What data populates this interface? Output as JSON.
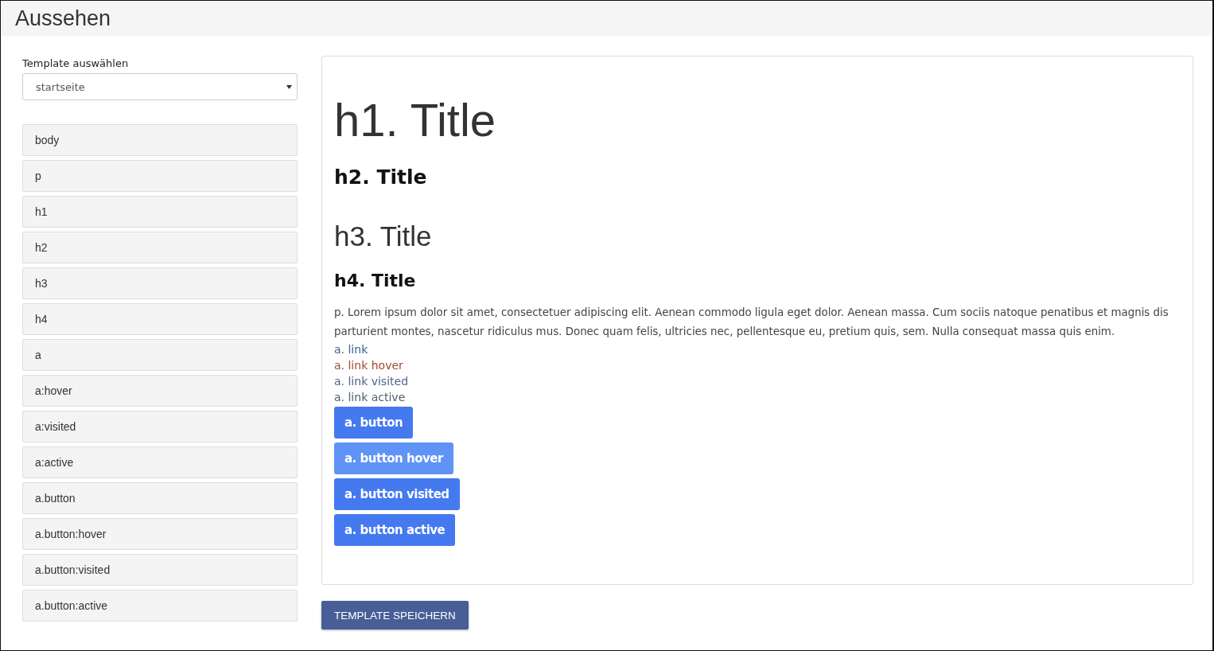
{
  "page": {
    "title": "Aussehen"
  },
  "template_select": {
    "label": "Template auswählen",
    "value": "startseite"
  },
  "element_list": [
    {
      "label": "body"
    },
    {
      "label": "p"
    },
    {
      "label": "h1"
    },
    {
      "label": "h2"
    },
    {
      "label": "h3"
    },
    {
      "label": "h4"
    },
    {
      "label": "a"
    },
    {
      "label": "a:hover"
    },
    {
      "label": "a:visited"
    },
    {
      "label": "a:active"
    },
    {
      "label": "a.button"
    },
    {
      "label": "a.button:hover"
    },
    {
      "label": "a.button:visited"
    },
    {
      "label": "a.button:active"
    }
  ],
  "preview": {
    "h1": "h1. Title",
    "h2": "h2. Title",
    "h3": "h3. Title",
    "h4": "h4. Title",
    "paragraph": "p. Lorem ipsum dolor sit amet, consectetuer adipiscing elit. Aenean commodo ligula eget dolor. Aenean massa. Cum sociis natoque penatibus et magnis dis parturient montes, nascetur ridiculus mus. Donec quam felis, ultricies nec, pellentesque eu, pretium quis, sem. Nulla consequat massa quis enim.",
    "links": [
      {
        "label": "a. link",
        "kind": "normal"
      },
      {
        "label": "a. link hover",
        "kind": "hover"
      },
      {
        "label": "a. link visited",
        "kind": "visited"
      },
      {
        "label": "a. link active",
        "kind": "active"
      }
    ],
    "buttons": [
      {
        "label": "a. button",
        "kind": "normal"
      },
      {
        "label": "a. button hover",
        "kind": "hover"
      },
      {
        "label": "a. button visited",
        "kind": "visited"
      },
      {
        "label": "a. button active",
        "kind": "active"
      }
    ]
  },
  "save_button": "TEMPLATE SPEICHERN"
}
